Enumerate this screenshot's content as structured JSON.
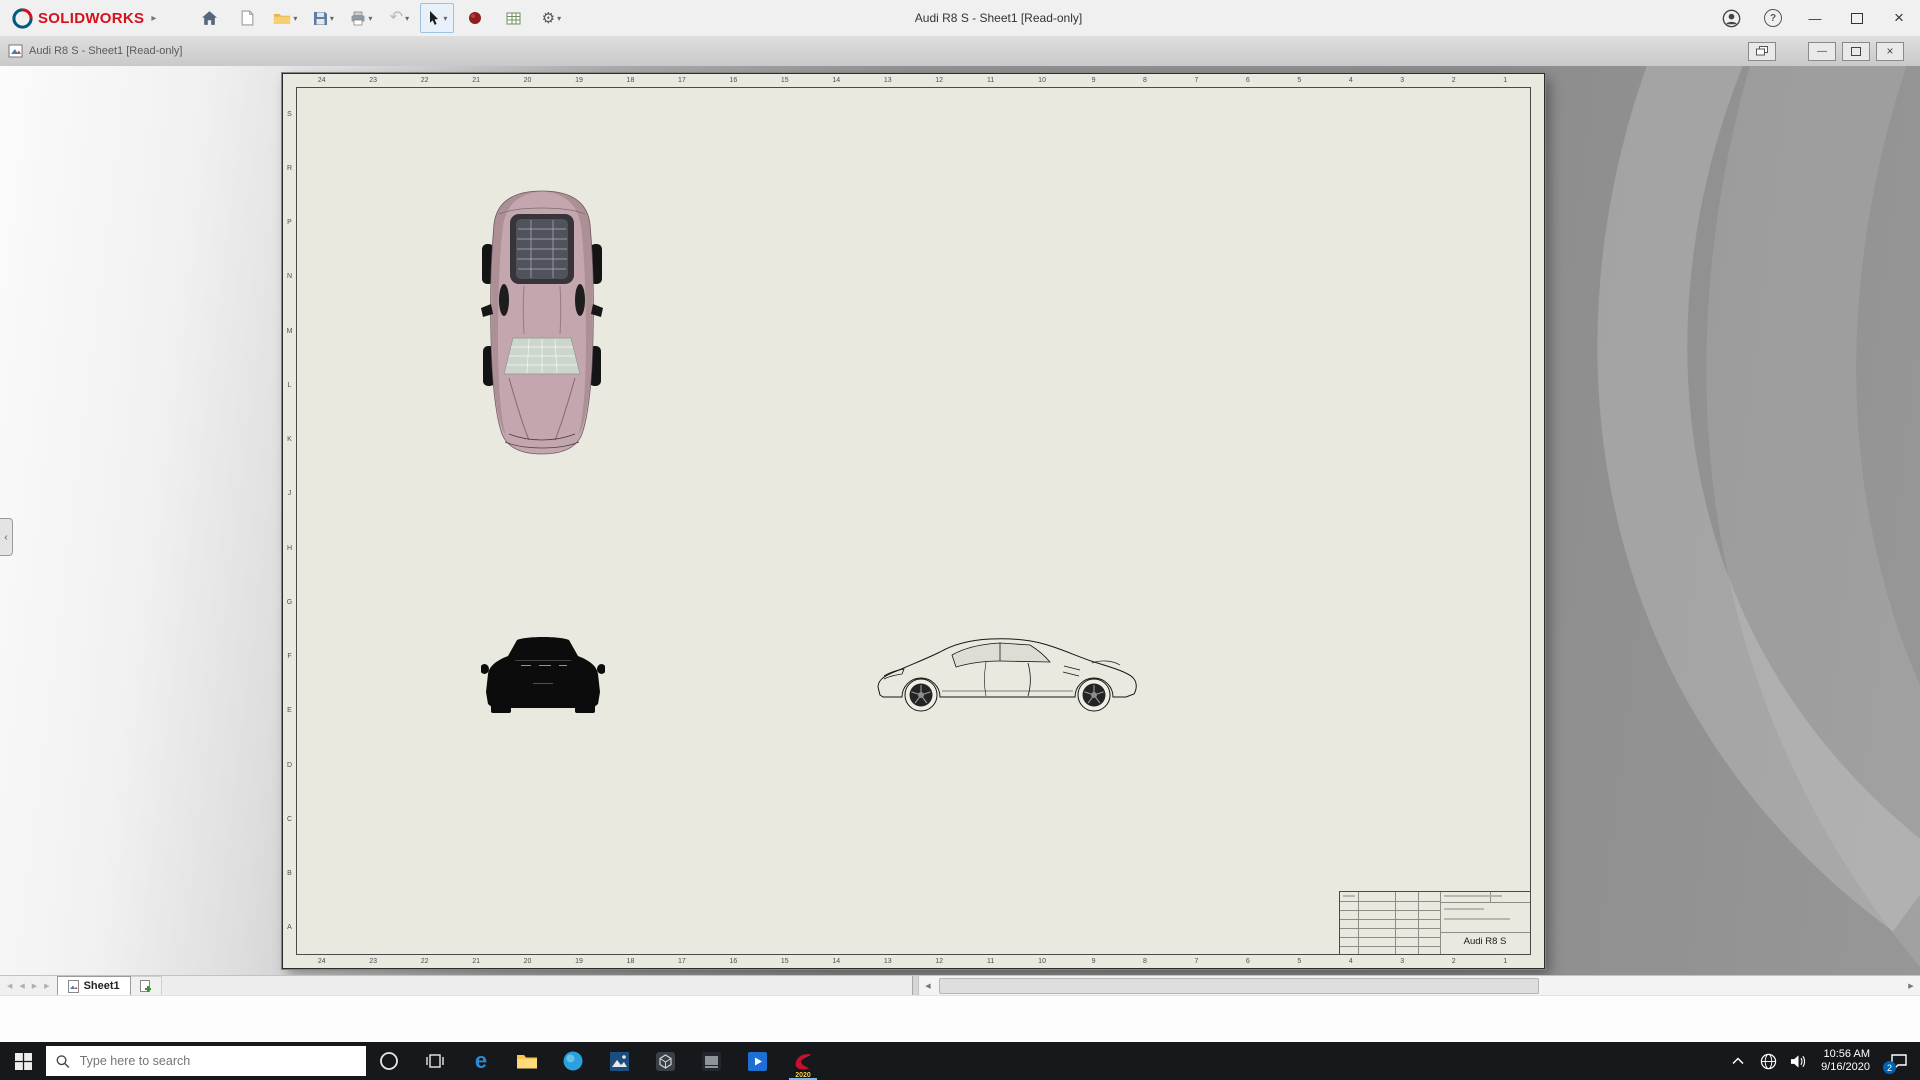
{
  "titlebar": {
    "brand": "SOLIDWORKS",
    "title": "Audi R8 S - Sheet1 [Read-only]"
  },
  "docbar": {
    "title": "Audi R8 S - Sheet1 [Read-only]"
  },
  "sheet": {
    "zone_numbers": [
      "24",
      "23",
      "22",
      "21",
      "20",
      "19",
      "18",
      "17",
      "16",
      "15",
      "14",
      "13",
      "12",
      "11",
      "10",
      "9",
      "8",
      "7",
      "6",
      "5",
      "4",
      "3",
      "2",
      "1"
    ],
    "zone_letters": [
      "S",
      "R",
      "P",
      "N",
      "M",
      "L",
      "K",
      "J",
      "H",
      "G",
      "F",
      "E",
      "D",
      "C",
      "B",
      "A"
    ],
    "title_block": {
      "part_name": "Audi R8 S"
    }
  },
  "tabs": {
    "sheet1_label": "Sheet1"
  },
  "taskbar": {
    "search_placeholder": "Type here to search",
    "solidworks_badge": "2020",
    "clock": {
      "time": "10:56 AM",
      "date": "9/16/2020"
    },
    "notification_badge": "2"
  },
  "icons": {
    "dropdown": "▾",
    "flyout_arrow": "▸",
    "undo": "↶",
    "gear": "⚙",
    "help": "?",
    "minimize": "—",
    "close": "×",
    "doc_minimize": "—",
    "doc_close": "×",
    "nav_first": "◀",
    "nav_prev": "◀",
    "nav_next": "▶",
    "nav_last": "▶",
    "scroll_left": "◀",
    "scroll_right": "▶",
    "panel_collapse": "‹",
    "edge_letter": "e"
  },
  "colors": {
    "brand_red": "#d6101c",
    "sheet_paper": "#eae9e0",
    "taskbar_dark": "#16181c",
    "active_tool_blue": "#9ec1e0",
    "running_indicator": "#76b9ed"
  }
}
